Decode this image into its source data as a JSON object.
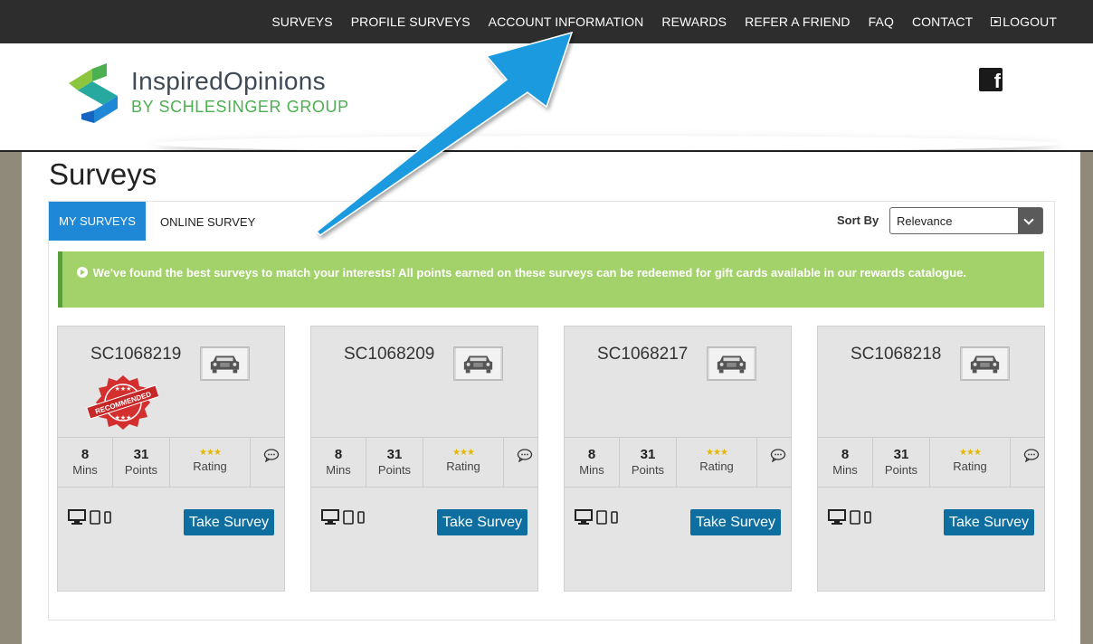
{
  "topnav": {
    "items": [
      "SURVEYS",
      "PROFILE SURVEYS",
      "ACCOUNT INFORMATION",
      "REWARDS",
      "REFER A FRIEND",
      "FAQ",
      "CONTACT"
    ],
    "logout": "LOGOUT"
  },
  "logo": {
    "name": "InspiredOpinions",
    "sub": "BY SCHLESINGER GROUP"
  },
  "social": {
    "icon": "facebook-icon"
  },
  "page": {
    "title": "Surveys"
  },
  "tabs": {
    "my_surveys": "MY SURVEYS",
    "online_survey": "ONLINE SURVEY"
  },
  "sort": {
    "label": "Sort By",
    "value": "Relevance"
  },
  "alert": {
    "text": "We've found the best surveys to match your interests! All points earned on these surveys can be redeemed for gift cards available in our rewards catalogue."
  },
  "cards": [
    {
      "code": "SC1068219",
      "mins": "8",
      "mins_label": "Mins",
      "points": "31",
      "points_label": "Points",
      "rating_label": "Rating",
      "stars": "★★★",
      "button": "Take Survey",
      "recommended": "RECOMMENDED"
    },
    {
      "code": "SC1068209",
      "mins": "8",
      "mins_label": "Mins",
      "points": "31",
      "points_label": "Points",
      "rating_label": "Rating",
      "stars": "★★★",
      "button": "Take Survey"
    },
    {
      "code": "SC1068217",
      "mins": "8",
      "mins_label": "Mins",
      "points": "31",
      "points_label": "Points",
      "rating_label": "Rating",
      "stars": "★★★",
      "button": "Take Survey"
    },
    {
      "code": "SC1068218",
      "mins": "8",
      "mins_label": "Mins",
      "points": "31",
      "points_label": "Points",
      "rating_label": "Rating",
      "stars": "★★★",
      "button": "Take Survey"
    }
  ],
  "colors": {
    "nav": "#2d2d2d",
    "tab_active": "#1e88d6",
    "alert": "#a3d16a",
    "button": "#0f6ea0",
    "annotation_arrow": "#1a9ae0"
  }
}
